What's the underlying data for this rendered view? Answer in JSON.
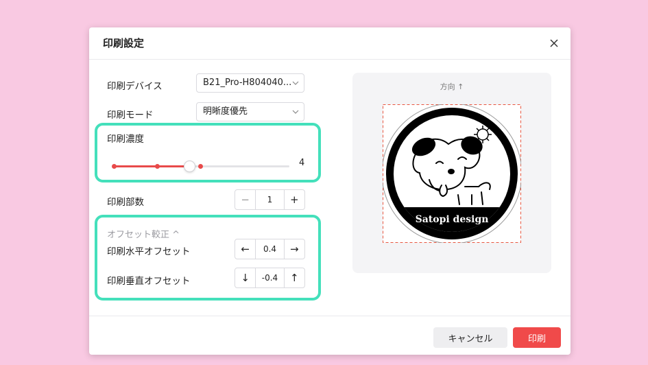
{
  "dialog": {
    "title": "印刷設定",
    "device": {
      "label": "印刷デバイス",
      "value": "B21_Pro-H804040..."
    },
    "mode": {
      "label": "印刷モード",
      "value": "明晰度優先"
    },
    "density": {
      "label": "印刷濃度",
      "value": "4",
      "level": 4,
      "steps": 5
    },
    "copies": {
      "label": "印刷部数",
      "value": "1",
      "minus": "−",
      "plus": "+"
    },
    "offset": {
      "header": "オフセット較正 ^",
      "horizontal": {
        "label": "印刷水平オフセット",
        "value": "0.4",
        "left": "←",
        "right": "→"
      },
      "vertical": {
        "label": "印刷垂直オフセット",
        "value": "-0.4",
        "down": "↓",
        "up": "↑"
      }
    },
    "preview": {
      "direction": "方向 ↑",
      "label_text": "Satopi design"
    },
    "footer": {
      "cancel": "キャンセル",
      "print": "印刷"
    }
  },
  "colors": {
    "accent": "#f04a4a",
    "highlight": "#44e0bb",
    "background": "#f9c9e2"
  },
  "icons": [
    "close-icon",
    "chevron-down-icon",
    "arrow-left-icon",
    "arrow-right-icon",
    "arrow-down-icon",
    "arrow-up-icon"
  ]
}
